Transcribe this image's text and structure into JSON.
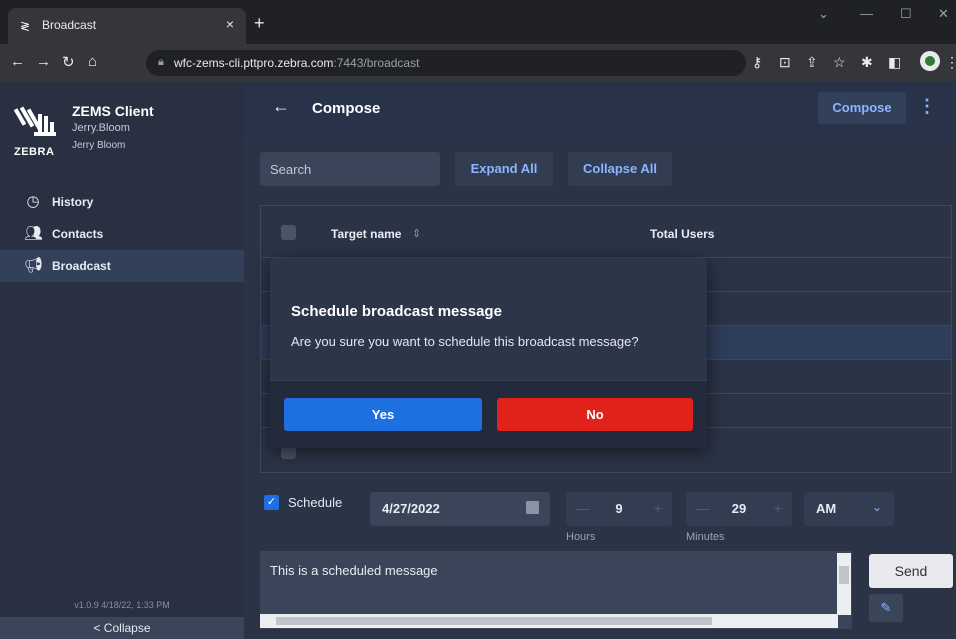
{
  "browser": {
    "tab_title": "Broadcast",
    "tab_close": "×",
    "new_tab": "+",
    "url_host": "wfc-zems-cli.pttpro.zebra.com",
    "url_path": ":7443/broadcast"
  },
  "sidebar": {
    "app_title": "ZEMS Client",
    "user_handle": "Jerry.Bloom",
    "user_name": "Jerry Bloom",
    "brand": "ZEBRA",
    "items": [
      {
        "label": "History",
        "icon": "history-icon"
      },
      {
        "label": "Contacts",
        "icon": "contacts-icon"
      },
      {
        "label": "Broadcast",
        "icon": "megaphone-icon",
        "active": true
      }
    ],
    "version": "v1.0.9 4/18/22, 1:33 PM",
    "collapse_label": "< Collapse"
  },
  "header": {
    "title": "Compose",
    "compose_label": "Compose"
  },
  "toolbar": {
    "search_placeholder": "Search",
    "expand_all": "Expand All",
    "collapse_all": "Collapse All"
  },
  "table": {
    "columns": [
      "Target name",
      "Total Users"
    ],
    "sort_glyph": "⇕"
  },
  "modal": {
    "title": "Schedule broadcast message",
    "message": "Are you sure you want to schedule this broadcast message?",
    "yes_label": "Yes",
    "no_label": "No"
  },
  "schedule": {
    "checkbox_label": "Schedule",
    "checked": true,
    "date": "4/27/2022",
    "hours": "9",
    "minutes": "29",
    "hours_label": "Hours",
    "minutes_label": "Minutes",
    "ampm": "AM"
  },
  "message": {
    "text": "This is a scheduled message",
    "send_label": "Send"
  },
  "colors": {
    "accent": "#8db4ff",
    "primary_button": "#1e6fe0",
    "danger_button": "#e0221b"
  }
}
